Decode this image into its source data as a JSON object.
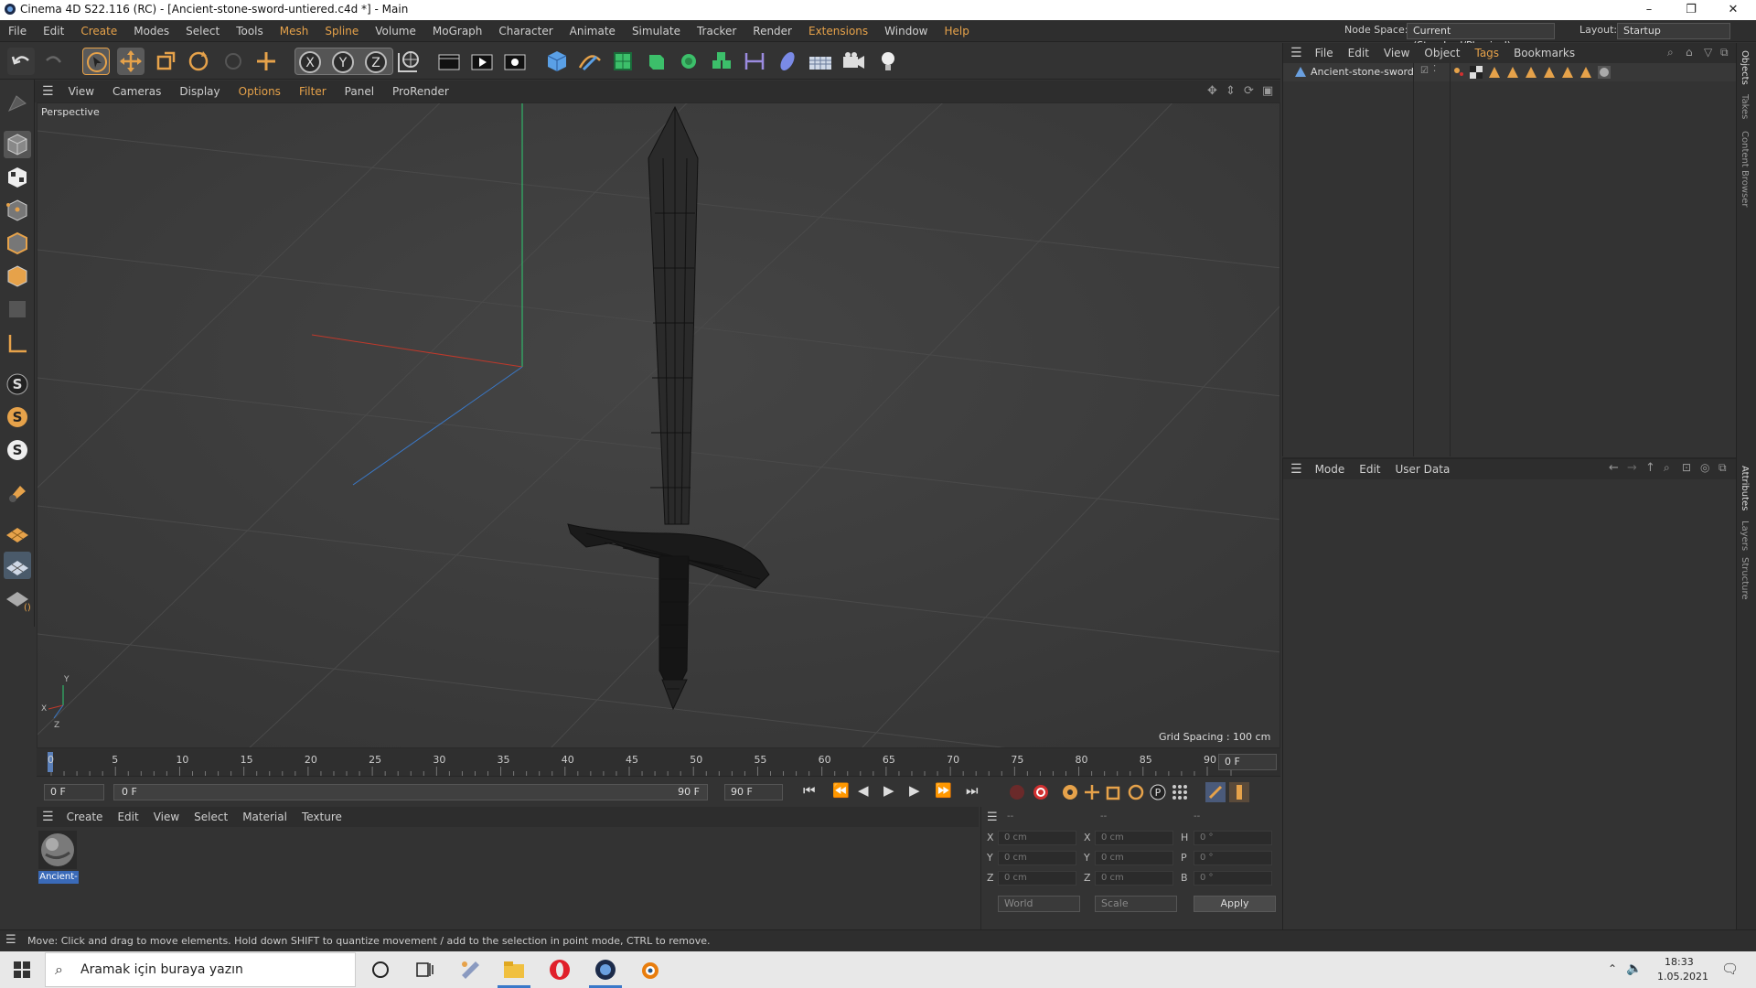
{
  "window": {
    "title": "Cinema 4D S22.116 (RC) - [Ancient-stone-sword-untiered.c4d *] - Main",
    "minimize": "–",
    "maximize": "❐",
    "close": "✕"
  },
  "menubar": {
    "items": [
      "File",
      "Edit",
      "Create",
      "Modes",
      "Select",
      "Tools",
      "Mesh",
      "Spline",
      "Volume",
      "MoGraph",
      "Character",
      "Animate",
      "Simulate",
      "Tracker",
      "Render",
      "Extensions",
      "Window",
      "Help"
    ],
    "node_space_label": "Node Space:",
    "node_space_value": "Current (Standard/Physical)",
    "layout_label": "Layout:",
    "layout_value": "Startup"
  },
  "viewport": {
    "menu": [
      "View",
      "Cameras",
      "Display",
      "Options",
      "Filter",
      "Panel",
      "ProRender"
    ],
    "label": "Perspective",
    "grid_spacing": "Grid Spacing : 100 cm"
  },
  "timeline": {
    "ticks": [
      "0",
      "5",
      "10",
      "15",
      "20",
      "25",
      "30",
      "35",
      "40",
      "45",
      "50",
      "55",
      "60",
      "65",
      "70",
      "75",
      "80",
      "85",
      "90"
    ],
    "current_frame": "0 F",
    "start_frame": "0 F",
    "range_start": "0 F",
    "range_end": "90 F",
    "end_frame": "90 F"
  },
  "material_manager": {
    "menu": [
      "Create",
      "Edit",
      "View",
      "Select",
      "Material",
      "Texture"
    ],
    "material_name": "Ancient-"
  },
  "coordinates": {
    "headers": [
      "--",
      "--",
      "--"
    ],
    "rows": [
      {
        "a": "X",
        "av": "0 cm",
        "b": "X",
        "bv": "0 cm",
        "c": "H",
        "cv": "0 °"
      },
      {
        "a": "Y",
        "av": "0 cm",
        "b": "Y",
        "bv": "0 cm",
        "c": "P",
        "cv": "0 °"
      },
      {
        "a": "Z",
        "av": "0 cm",
        "b": "Z",
        "bv": "0 cm",
        "c": "B",
        "cv": "0 °"
      }
    ],
    "mode_select": "World",
    "scale_select": "Scale",
    "apply_label": "Apply"
  },
  "object_manager": {
    "menu": [
      "File",
      "Edit",
      "View",
      "Object",
      "Tags",
      "Bookmarks"
    ],
    "object_name": "Ancient-stone-sword"
  },
  "attribute_manager": {
    "menu": [
      "Mode",
      "Edit",
      "User Data"
    ]
  },
  "side_tabs": {
    "top": [
      "Objects",
      "Takes",
      "Content Browser"
    ],
    "bottom": [
      "Attributes",
      "Layers",
      "Structure"
    ]
  },
  "status_text": "Move: Click and drag to move elements. Hold down SHIFT to quantize movement / add to the selection in point mode, CTRL to remove.",
  "taskbar": {
    "search_placeholder": "Aramak için buraya yazın",
    "time": "18:33",
    "date": "1.05.2021"
  },
  "colors": {
    "accent_orange": "#e6a24a",
    "axis_x": "#c0392b",
    "axis_y": "#2ecc71",
    "axis_z": "#3a79c9"
  }
}
